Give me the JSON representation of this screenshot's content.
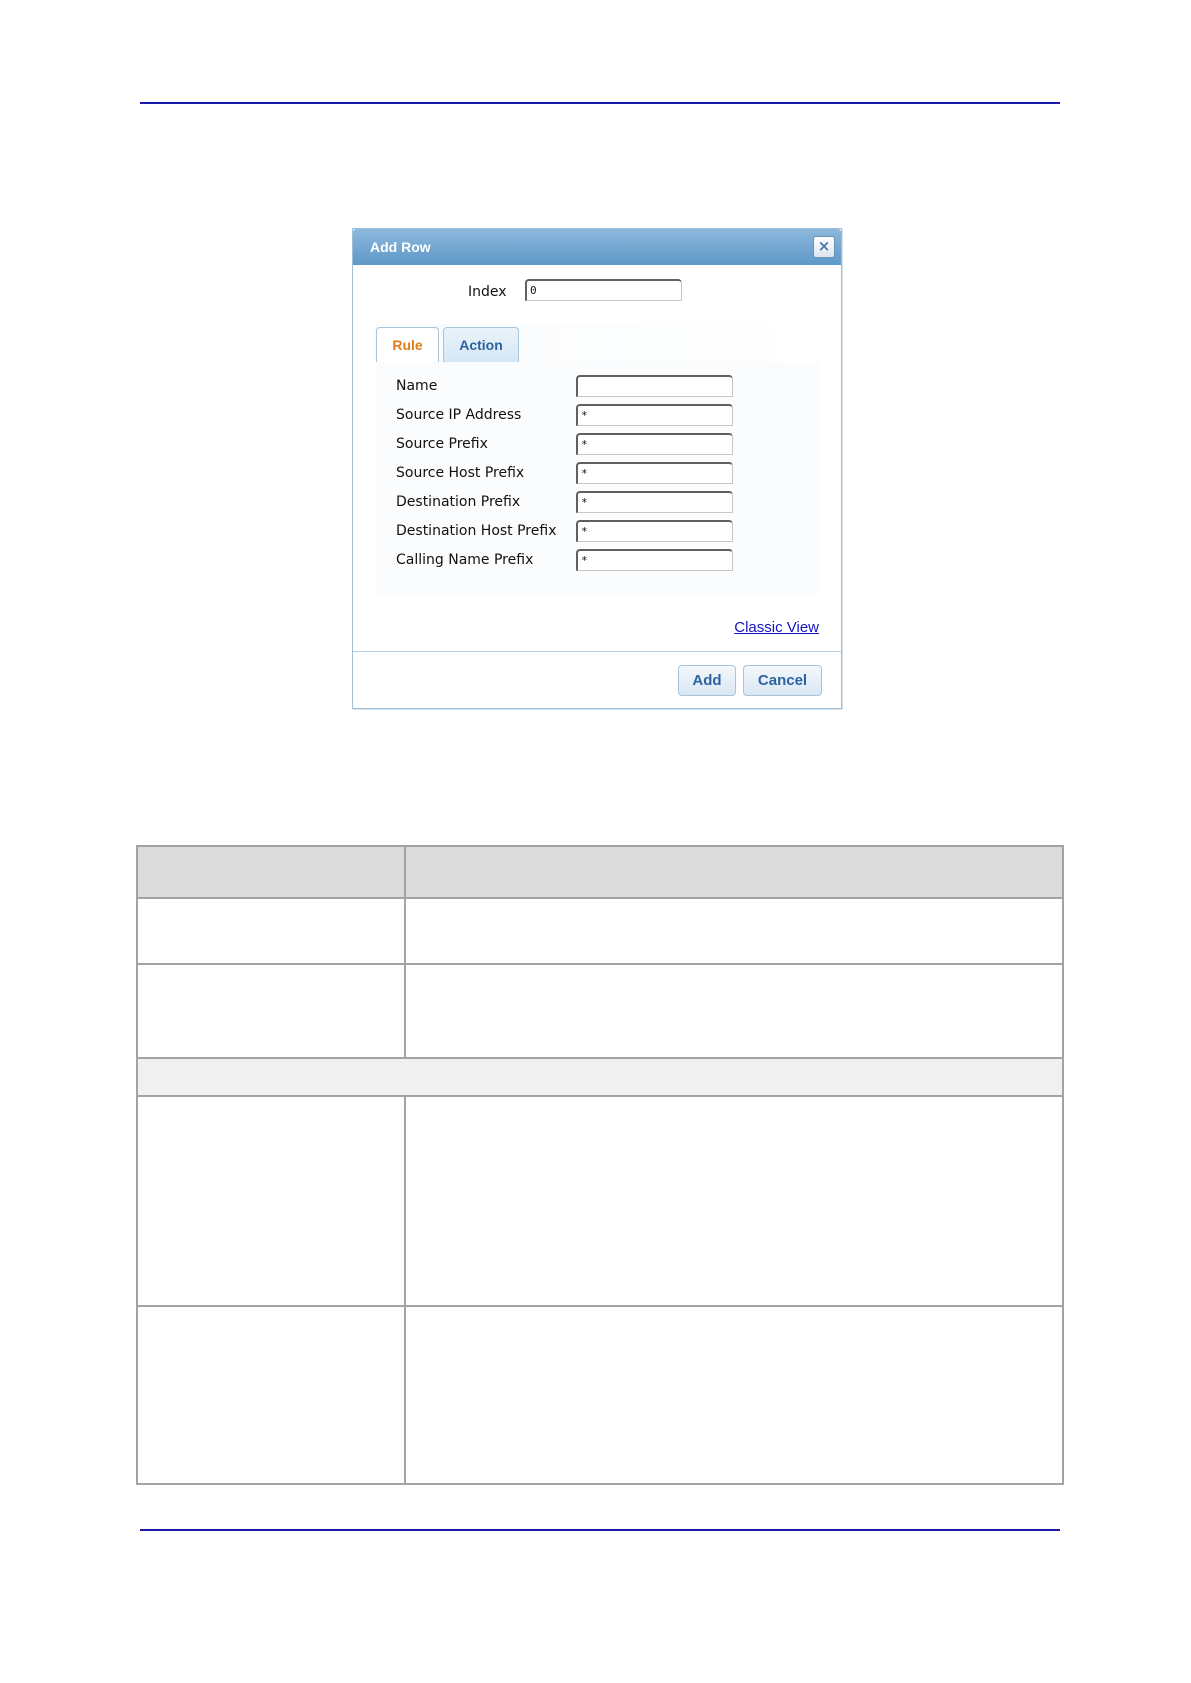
{
  "dialog": {
    "title": "Add Row",
    "close_icon": "close-icon",
    "index": {
      "label": "Index",
      "value": "0"
    },
    "tabs": [
      {
        "label": "Rule",
        "active": true
      },
      {
        "label": "Action",
        "active": false
      }
    ],
    "fields": [
      {
        "label": "Name",
        "value": ""
      },
      {
        "label": "Source IP Address",
        "value": "*"
      },
      {
        "label": "Source Prefix",
        "value": "*"
      },
      {
        "label": "Source Host Prefix",
        "value": "*"
      },
      {
        "label": "Destination Prefix",
        "value": "*"
      },
      {
        "label": "Destination Host Prefix",
        "value": "*"
      },
      {
        "label": "Calling Name Prefix",
        "value": "*"
      }
    ],
    "classic_view_link": "Classic View",
    "buttons": {
      "add": "Add",
      "cancel": "Cancel"
    }
  },
  "colors": {
    "header_rule": "#1a1aa8",
    "titlebar": "#6ea3d0",
    "active_tab_text": "#e07d19",
    "tab_text": "#2e62a0",
    "link": "#1515c0"
  }
}
